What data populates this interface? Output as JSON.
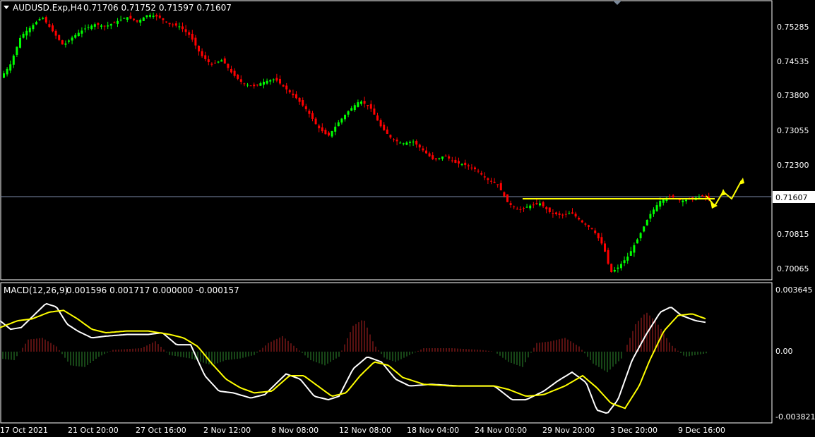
{
  "header": {
    "symbol": "AUDUSD.Exp,H4",
    "ohlc": "0.71706 0.71752 0.71597 0.71607"
  },
  "macd_header": {
    "label": "MACD(12,26,9)",
    "values": "0.001596 0.001717 0.000000 -0.000157"
  },
  "colors": {
    "background": "#000000",
    "bull": "#00ff00",
    "bear": "#ff0000",
    "macd_line": "#ffffff",
    "signal_line": "#ffff00",
    "hist_pos": "#b22222",
    "hist_neg": "#2e8b2e",
    "frame": "#ffffff",
    "price_line": "#7d8aa8",
    "annotation": "#ffff00"
  },
  "chart_data": [
    {
      "type": "candlestick",
      "title": "AUDUSD.Exp,H4",
      "price_ticks": [
        "0.75285",
        "0.74535",
        "0.73800",
        "0.73055",
        "0.72300",
        "0.70815",
        "0.70065"
      ],
      "current_price": "0.71607",
      "ylim": [
        0.6993,
        0.7571
      ],
      "x_ticks": [
        "17 Oct 2021",
        "21 Oct 20:00",
        "27 Oct 16:00",
        "2 Nov 12:00",
        "8 Nov 08:00",
        "12 Nov 08:00",
        "18 Nov 04:00",
        "24 Nov 00:00",
        "29 Nov 20:00",
        "3 Dec 20:00",
        "9 Dec 16:00"
      ],
      "close_trend": [
        [
          0,
          0.741
        ],
        [
          15,
          0.744
        ],
        [
          30,
          0.75
        ],
        [
          45,
          0.752
        ],
        [
          60,
          0.754
        ],
        [
          75,
          0.751
        ],
        [
          90,
          0.748
        ],
        [
          105,
          0.75
        ],
        [
          120,
          0.7515
        ],
        [
          135,
          0.7525
        ],
        [
          150,
          0.752
        ],
        [
          165,
          0.753
        ],
        [
          180,
          0.754
        ],
        [
          195,
          0.753
        ],
        [
          210,
          0.7545
        ],
        [
          225,
          0.754
        ],
        [
          240,
          0.7525
        ],
        [
          255,
          0.752
        ],
        [
          270,
          0.75
        ],
        [
          285,
          0.746
        ],
        [
          300,
          0.744
        ],
        [
          315,
          0.745
        ],
        [
          330,
          0.742
        ],
        [
          345,
          0.74
        ],
        [
          360,
          0.7395
        ],
        [
          375,
          0.7405
        ],
        [
          390,
          0.741
        ],
        [
          405,
          0.739
        ],
        [
          420,
          0.737
        ],
        [
          435,
          0.7345
        ],
        [
          450,
          0.731
        ],
        [
          465,
          0.729
        ],
        [
          480,
          0.732
        ],
        [
          495,
          0.7345
        ],
        [
          510,
          0.7365
        ],
        [
          525,
          0.735
        ],
        [
          540,
          0.731
        ],
        [
          555,
          0.7285
        ],
        [
          570,
          0.7275
        ],
        [
          585,
          0.728
        ],
        [
          600,
          0.726
        ],
        [
          615,
          0.724
        ],
        [
          630,
          0.725
        ],
        [
          645,
          0.7235
        ],
        [
          660,
          0.723
        ],
        [
          675,
          0.722
        ],
        [
          690,
          0.72
        ],
        [
          705,
          0.719
        ],
        [
          720,
          0.715
        ],
        [
          735,
          0.7135
        ],
        [
          750,
          0.7145
        ],
        [
          765,
          0.715
        ],
        [
          780,
          0.713
        ],
        [
          795,
          0.7125
        ],
        [
          810,
          0.713
        ],
        [
          825,
          0.711
        ],
        [
          840,
          0.7095
        ],
        [
          855,
          0.706
        ],
        [
          865,
          0.7005
        ],
        [
          875,
          0.7015
        ],
        [
          890,
          0.704
        ],
        [
          905,
          0.708
        ],
        [
          920,
          0.7125
        ],
        [
          935,
          0.7155
        ],
        [
          950,
          0.7165
        ],
        [
          965,
          0.7155
        ],
        [
          980,
          0.716
        ],
        [
          995,
          0.7165
        ],
        [
          1003,
          0.7161
        ]
      ]
    },
    {
      "type": "line",
      "title": "MACD(12,26,9)",
      "y_ticks": [
        "0.003645",
        "0.00",
        "-0.003821"
      ],
      "ylim": [
        -0.003821,
        0.003645
      ],
      "series": [
        {
          "name": "MACD",
          "points": [
            [
              0,
              0.0018
            ],
            [
              15,
              0.0013
            ],
            [
              30,
              0.0014
            ],
            [
              50,
              0.0022
            ],
            [
              65,
              0.0028
            ],
            [
              80,
              0.0026
            ],
            [
              95,
              0.0016
            ],
            [
              110,
              0.0012
            ],
            [
              130,
              0.0008
            ],
            [
              150,
              0.0009
            ],
            [
              180,
              0.001
            ],
            [
              210,
              0.001
            ],
            [
              230,
              0.0011
            ],
            [
              250,
              0.0004
            ],
            [
              270,
              0.0004
            ],
            [
              290,
              -0.0014
            ],
            [
              310,
              -0.0023
            ],
            [
              330,
              -0.0024
            ],
            [
              355,
              -0.0027
            ],
            [
              375,
              -0.0025
            ],
            [
              390,
              -0.0019
            ],
            [
              405,
              -0.0013
            ],
            [
              425,
              -0.0016
            ],
            [
              445,
              -0.0026
            ],
            [
              465,
              -0.0028
            ],
            [
              480,
              -0.0026
            ],
            [
              500,
              -0.001
            ],
            [
              520,
              -0.0003
            ],
            [
              540,
              -0.0006
            ],
            [
              560,
              -0.0016
            ],
            [
              580,
              -0.002
            ],
            [
              610,
              -0.0019
            ],
            [
              650,
              -0.002
            ],
            [
              700,
              -0.002
            ],
            [
              725,
              -0.0028
            ],
            [
              745,
              -0.0028
            ],
            [
              770,
              -0.0023
            ],
            [
              790,
              -0.0017
            ],
            [
              810,
              -0.0012
            ],
            [
              830,
              -0.0018
            ],
            [
              845,
              -0.0034
            ],
            [
              860,
              -0.0036
            ],
            [
              875,
              -0.0028
            ],
            [
              895,
              -0.0005
            ],
            [
              915,
              0.001
            ],
            [
              935,
              0.0023
            ],
            [
              950,
              0.0026
            ],
            [
              965,
              0.0021
            ],
            [
              985,
              0.0018
            ],
            [
              1000,
              0.0017
            ]
          ]
        },
        {
          "name": "Signal",
          "points": [
            [
              0,
              0.0014
            ],
            [
              25,
              0.0018
            ],
            [
              45,
              0.0019
            ],
            [
              70,
              0.0023
            ],
            [
              90,
              0.0024
            ],
            [
              110,
              0.0019
            ],
            [
              130,
              0.0013
            ],
            [
              150,
              0.0011
            ],
            [
              180,
              0.0012
            ],
            [
              210,
              0.0012
            ],
            [
              240,
              0.001
            ],
            [
              260,
              0.0008
            ],
            [
              280,
              0.0003
            ],
            [
              300,
              -0.0007
            ],
            [
              320,
              -0.0016
            ],
            [
              340,
              -0.0021
            ],
            [
              360,
              -0.0024
            ],
            [
              385,
              -0.0023
            ],
            [
              410,
              -0.0014
            ],
            [
              430,
              -0.0014
            ],
            [
              450,
              -0.002
            ],
            [
              470,
              -0.0026
            ],
            [
              490,
              -0.0024
            ],
            [
              510,
              -0.0014
            ],
            [
              530,
              -0.0006
            ],
            [
              550,
              -0.0008
            ],
            [
              570,
              -0.0015
            ],
            [
              600,
              -0.0019
            ],
            [
              640,
              -0.002
            ],
            [
              700,
              -0.002
            ],
            [
              720,
              -0.0022
            ],
            [
              745,
              -0.0026
            ],
            [
              770,
              -0.0025
            ],
            [
              800,
              -0.002
            ],
            [
              825,
              -0.0014
            ],
            [
              845,
              -0.0021
            ],
            [
              865,
              -0.003
            ],
            [
              885,
              -0.0033
            ],
            [
              905,
              -0.002
            ],
            [
              920,
              -0.0005
            ],
            [
              940,
              0.0012
            ],
            [
              960,
              0.0021
            ],
            [
              980,
              0.0022
            ],
            [
              1000,
              0.0019
            ]
          ]
        },
        {
          "name": "Histogram",
          "type": "bar",
          "points": [
            [
              0,
              -0.0004
            ],
            [
              20,
              -0.0005
            ],
            [
              40,
              0.0007
            ],
            [
              60,
              0.0008
            ],
            [
              80,
              0.0003
            ],
            [
              100,
              -0.0008
            ],
            [
              120,
              -0.0009
            ],
            [
              140,
              -0.0003
            ],
            [
              160,
              0.0001
            ],
            [
              200,
              0.0002
            ],
            [
              220,
              0.0006
            ],
            [
              240,
              -0.0002
            ],
            [
              270,
              -0.0004
            ],
            [
              300,
              -0.0008
            ],
            [
              320,
              -0.0005
            ],
            [
              340,
              -0.0004
            ],
            [
              360,
              -0.0002
            ],
            [
              380,
              0.0005
            ],
            [
              400,
              0.0009
            ],
            [
              420,
              0.0002
            ],
            [
              440,
              -0.0005
            ],
            [
              460,
              -0.0008
            ],
            [
              480,
              -0.0003
            ],
            [
              500,
              0.0015
            ],
            [
              515,
              0.0019
            ],
            [
              530,
              0.0004
            ],
            [
              545,
              -0.0004
            ],
            [
              560,
              -0.0006
            ],
            [
              580,
              -0.0002
            ],
            [
              600,
              0.0002
            ],
            [
              640,
              0.0002
            ],
            [
              680,
              0.0001
            ],
            [
              700,
              0.0
            ],
            [
              720,
              -0.0006
            ],
            [
              740,
              -0.0009
            ],
            [
              760,
              0.0005
            ],
            [
              780,
              0.0006
            ],
            [
              800,
              0.0008
            ],
            [
              820,
              0.0003
            ],
            [
              840,
              -0.0007
            ],
            [
              860,
              -0.0012
            ],
            [
              880,
              -0.0004
            ],
            [
              900,
              0.0016
            ],
            [
              915,
              0.0023
            ],
            [
              930,
              0.0017
            ],
            [
              950,
              0.0004
            ],
            [
              970,
              -0.0003
            ],
            [
              985,
              -0.0002
            ],
            [
              1000,
              -0.0001
            ]
          ]
        }
      ]
    }
  ]
}
